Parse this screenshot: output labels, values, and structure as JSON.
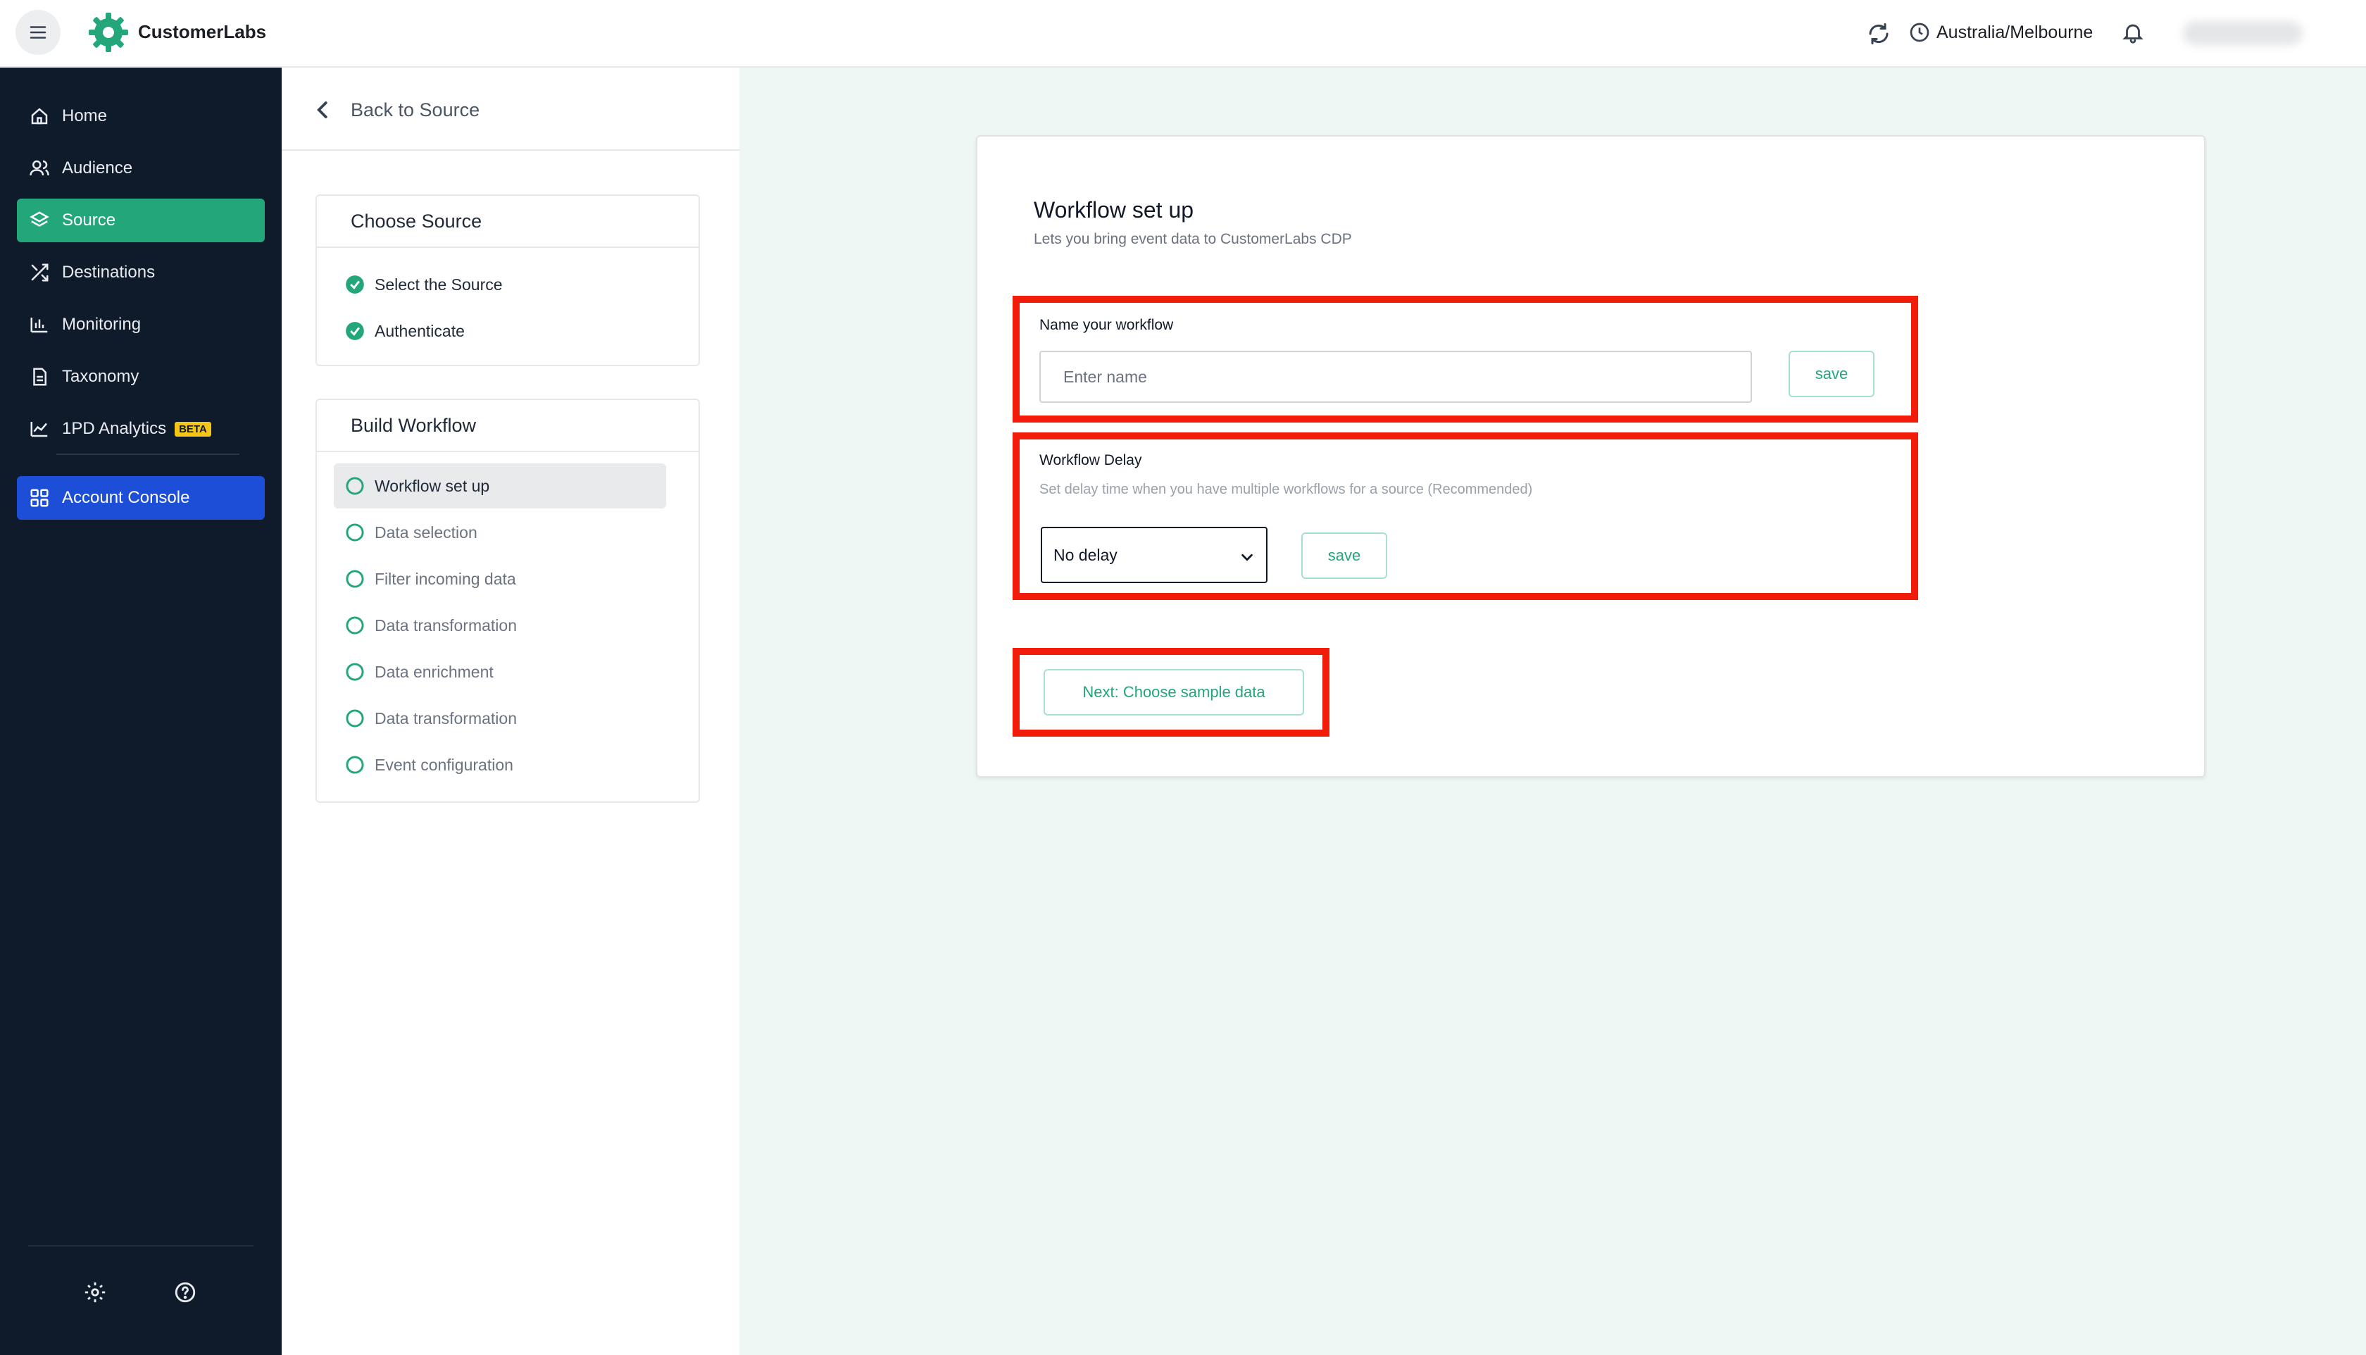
{
  "app": {
    "brand": "CustomerLabs"
  },
  "topbar": {
    "timezone": "Australia/Melbourne"
  },
  "sidebar": {
    "items": [
      {
        "label": "Home",
        "icon": "home-icon"
      },
      {
        "label": "Audience",
        "icon": "users-icon"
      },
      {
        "label": "Source",
        "icon": "layers-icon",
        "active": true
      },
      {
        "label": "Destinations",
        "icon": "shuffle-icon"
      },
      {
        "label": "Monitoring",
        "icon": "bar-chart-icon"
      },
      {
        "label": "Taxonomy",
        "icon": "document-icon"
      },
      {
        "label": "1PD Analytics",
        "icon": "line-chart-icon",
        "badge": "BETA"
      }
    ],
    "console": {
      "label": "Account Console",
      "icon": "grid-icon"
    }
  },
  "leftpanel": {
    "back_label": "Back to Source",
    "choose_source": {
      "title": "Choose Source",
      "steps": [
        "Select the Source",
        "Authenticate"
      ]
    },
    "build_workflow": {
      "title": "Build Workflow",
      "steps": [
        "Workflow set up",
        "Data selection",
        "Filter incoming data",
        "Data transformation",
        "Data enrichment",
        "Data transformation",
        "Event configuration"
      ]
    }
  },
  "main": {
    "title": "Workflow set up",
    "subtitle": "Lets you bring event data to CustomerLabs CDP",
    "name_section": {
      "label": "Name your workflow",
      "placeholder": "Enter name",
      "save_label": "save"
    },
    "delay_section": {
      "label": "Workflow Delay",
      "hint": "Set delay time when you have multiple workflows for a source (Recommended)",
      "selected": "No delay",
      "save_label": "save"
    },
    "next_label": "Next: Choose sample data"
  },
  "colors": {
    "accent": "#22a67a",
    "sidebar_bg": "#0f1a2a",
    "console": "#1d4ed8",
    "highlight": "#f11d0a",
    "main_bg": "#eff7f4"
  }
}
